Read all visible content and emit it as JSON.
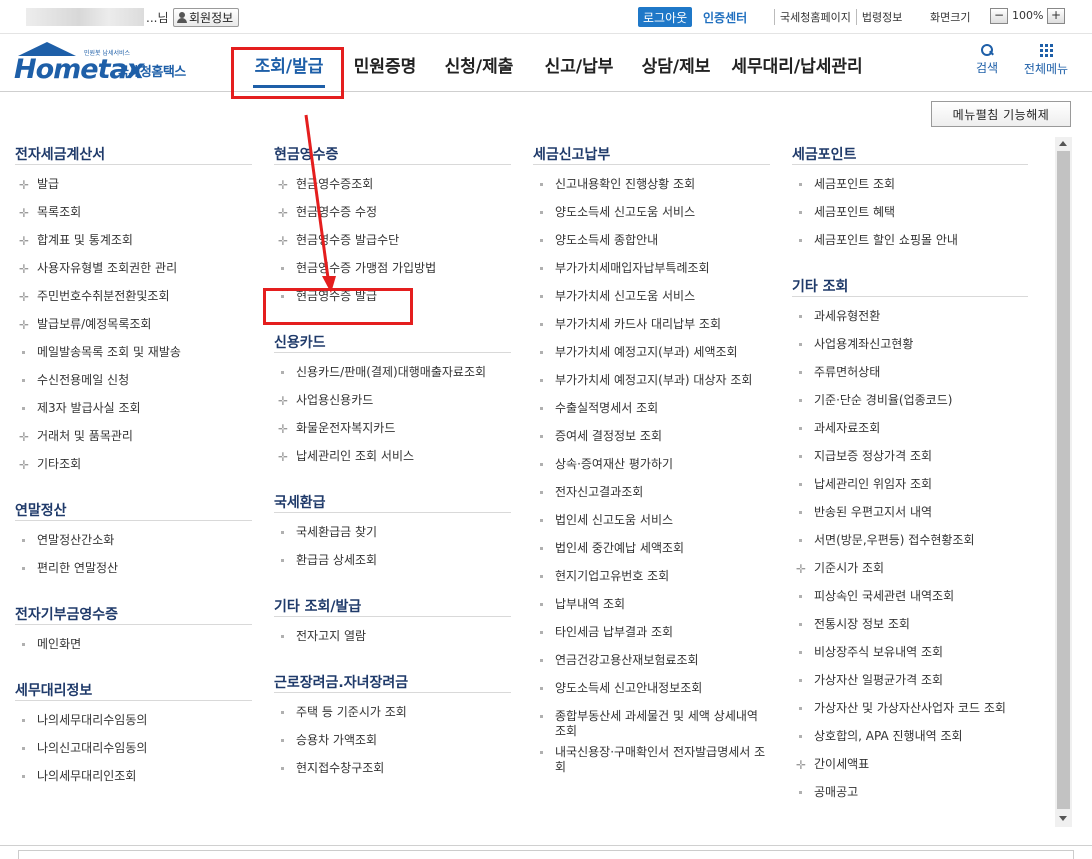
{
  "topbar": {
    "user_suffix": "...님",
    "member_info": "회원정보",
    "logout": "로그아웃",
    "certification": "인증센터",
    "links": [
      "국세청홈페이지",
      "법령정보"
    ],
    "screen_size": "화면크기",
    "zoom_minus": "−",
    "zoom_value": "100%",
    "zoom_plus": "+"
  },
  "logo": {
    "tagline": "민원봇 납세서비스",
    "brand": "Hometax",
    "brand_kr": "국세청홈택스"
  },
  "gnb": {
    "items": [
      "조회/발급",
      "민원증명",
      "신청/제출",
      "신고/납부",
      "상담/제보",
      "세무대리/납세관리"
    ],
    "search": "검색",
    "all_menu": "전체메뉴"
  },
  "edit_button": "메뉴펼침 기능해제",
  "columns": [
    {
      "sections": [
        {
          "title": "전자세금계산서",
          "items": [
            {
              "label": "발급",
              "marker": "plus"
            },
            {
              "label": "목록조회",
              "marker": "plus"
            },
            {
              "label": "합계표 및 통계조회",
              "marker": "plus"
            },
            {
              "label": "사용자유형별 조회권한 관리",
              "marker": "plus"
            },
            {
              "label": "주민번호수취분전환및조회",
              "marker": "plus"
            },
            {
              "label": "발급보류/예정목록조회",
              "marker": "plus"
            },
            {
              "label": "메일발송목록 조회 및 재발송",
              "marker": "dot"
            },
            {
              "label": "수신전용메일 신청",
              "marker": "dot"
            },
            {
              "label": "제3자 발급사실 조회",
              "marker": "dot"
            },
            {
              "label": "거래처 및 품목관리",
              "marker": "plus"
            },
            {
              "label": "기타조회",
              "marker": "plus"
            }
          ]
        },
        {
          "title": "연말정산",
          "items": [
            {
              "label": "연말정산간소화",
              "marker": "dot"
            },
            {
              "label": "편리한 연말정산",
              "marker": "dot"
            }
          ]
        },
        {
          "title": "전자기부금영수증",
          "items": [
            {
              "label": "메인화면",
              "marker": "dot"
            }
          ]
        },
        {
          "title": "세무대리정보",
          "items": [
            {
              "label": "나의세무대리수임동의",
              "marker": "dot"
            },
            {
              "label": "나의신고대리수임동의",
              "marker": "dot"
            },
            {
              "label": "나의세무대리인조회",
              "marker": "dot"
            }
          ]
        }
      ]
    },
    {
      "sections": [
        {
          "title": "현금영수증",
          "items": [
            {
              "label": "현금영수증조회",
              "marker": "plus"
            },
            {
              "label": "현금영수증 수정",
              "marker": "plus"
            },
            {
              "label": "현금영수증 발급수단",
              "marker": "plus"
            },
            {
              "label": "현금영수증 가맹점 가입방법",
              "marker": "dot"
            },
            {
              "label": "현금영수증 발급",
              "marker": "dot"
            }
          ]
        },
        {
          "title": "신용카드",
          "items": [
            {
              "label": "신용카드/판매(결제)대행매출자료조회",
              "marker": "dot"
            },
            {
              "label": "사업용신용카드",
              "marker": "plus"
            },
            {
              "label": "화물운전자복지카드",
              "marker": "plus"
            },
            {
              "label": "납세관리인 조회 서비스",
              "marker": "plus"
            }
          ]
        },
        {
          "title": "국세환급",
          "items": [
            {
              "label": "국세환급금 찾기",
              "marker": "dot"
            },
            {
              "label": "환급금 상세조회",
              "marker": "dot"
            }
          ]
        },
        {
          "title": "기타 조회/발급",
          "items": [
            {
              "label": "전자고지 열람",
              "marker": "dot"
            }
          ]
        },
        {
          "title": "근로장려금.자녀장려금",
          "items": [
            {
              "label": "주택 등 기준시가 조회",
              "marker": "dot"
            },
            {
              "label": "승용차 가액조회",
              "marker": "dot"
            },
            {
              "label": "현지접수창구조회",
              "marker": "dot"
            }
          ]
        }
      ]
    },
    {
      "sections": [
        {
          "title": "세금신고납부",
          "items": [
            {
              "label": "신고내용확인 진행상황 조회",
              "marker": "dot"
            },
            {
              "label": "양도소득세 신고도움 서비스",
              "marker": "dot"
            },
            {
              "label": "양도소득세 종합안내",
              "marker": "dot"
            },
            {
              "label": "부가가치세매입자납부특례조회",
              "marker": "dot"
            },
            {
              "label": "부가가치세 신고도움 서비스",
              "marker": "dot"
            },
            {
              "label": "부가가치세 카드사 대리납부 조회",
              "marker": "dot"
            },
            {
              "label": "부가가치세 예정고지(부과) 세액조회",
              "marker": "dot"
            },
            {
              "label": "부가가치세 예정고지(부과) 대상자 조회",
              "marker": "dot"
            },
            {
              "label": "수출실적명세서 조회",
              "marker": "dot"
            },
            {
              "label": "증여세 결정정보 조회",
              "marker": "dot"
            },
            {
              "label": "상속·증여재산 평가하기",
              "marker": "dot"
            },
            {
              "label": "전자신고결과조회",
              "marker": "dot"
            },
            {
              "label": "법인세 신고도움 서비스",
              "marker": "dot"
            },
            {
              "label": "법인세 중간예납 세액조회",
              "marker": "dot"
            },
            {
              "label": "현지기업고유번호 조회",
              "marker": "dot"
            },
            {
              "label": "납부내역 조회",
              "marker": "dot"
            },
            {
              "label": "타인세금 납부결과 조회",
              "marker": "dot"
            },
            {
              "label": "연금건강고용산재보험료조회",
              "marker": "dot"
            },
            {
              "label": "양도소득세 신고안내정보조회",
              "marker": "dot"
            },
            {
              "label": "종합부동산세 과세물건 및 세액 상세내역 조회",
              "marker": "dot"
            },
            {
              "label": "내국신용장·구매확인서 전자발급명세서 조회",
              "marker": "dot"
            }
          ]
        }
      ]
    },
    {
      "sections": [
        {
          "title": "세금포인트",
          "items": [
            {
              "label": "세금포인트 조회",
              "marker": "dot"
            },
            {
              "label": "세금포인트 혜택",
              "marker": "dot"
            },
            {
              "label": "세금포인트 할인 쇼핑몰 안내",
              "marker": "dot"
            }
          ]
        },
        {
          "title": "기타 조회",
          "items": [
            {
              "label": "과세유형전환",
              "marker": "dot"
            },
            {
              "label": "사업용계좌신고현황",
              "marker": "dot"
            },
            {
              "label": "주류면허상태",
              "marker": "dot"
            },
            {
              "label": "기준·단순 경비율(업종코드)",
              "marker": "dot"
            },
            {
              "label": "과세자료조회",
              "marker": "dot"
            },
            {
              "label": "지급보증 정상가격 조회",
              "marker": "dot"
            },
            {
              "label": "납세관리인 위임자 조회",
              "marker": "dot"
            },
            {
              "label": "반송된 우편고지서 내역",
              "marker": "dot"
            },
            {
              "label": "서면(방문,우편등) 접수현황조회",
              "marker": "dot"
            },
            {
              "label": "기준시가 조회",
              "marker": "plus"
            },
            {
              "label": "피상속인 국세관련 내역조회",
              "marker": "dot"
            },
            {
              "label": "전통시장 정보 조회",
              "marker": "dot"
            },
            {
              "label": "비상장주식 보유내역 조회",
              "marker": "dot"
            },
            {
              "label": "가상자산 일평균가격 조회",
              "marker": "dot"
            },
            {
              "label": "가상자산 및 가상자산사업자 코드 조회",
              "marker": "dot"
            },
            {
              "label": "상호합의, APA 진행내역 조회",
              "marker": "dot"
            },
            {
              "label": "간이세액표",
              "marker": "plus"
            },
            {
              "label": "공매공고",
              "marker": "dot"
            }
          ]
        }
      ]
    }
  ]
}
